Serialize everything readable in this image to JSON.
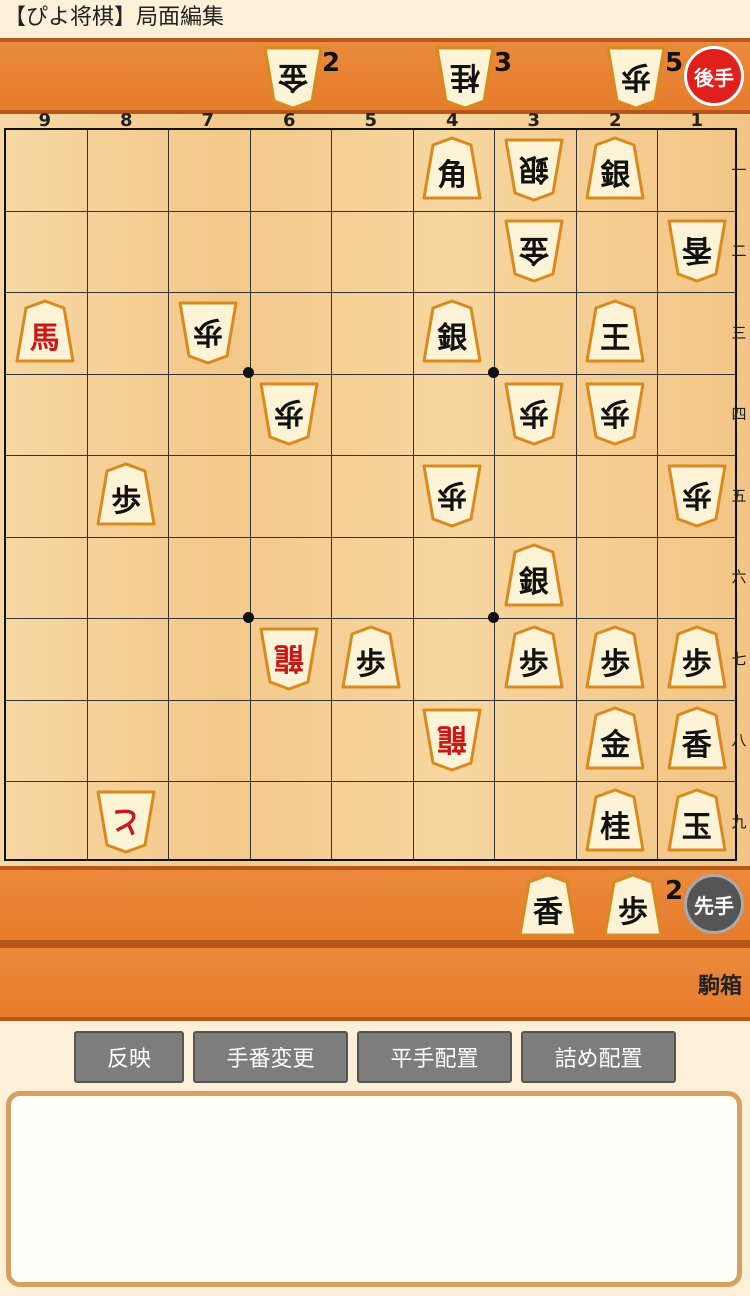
{
  "title": "【ぴよ将棋】局面編集",
  "col_labels": [
    "9",
    "8",
    "7",
    "6",
    "5",
    "4",
    "3",
    "2",
    "1"
  ],
  "row_labels": [
    "一",
    "二",
    "三",
    "四",
    "五",
    "六",
    "七",
    "八",
    "九"
  ],
  "board": [
    {
      "file": 4,
      "rank": 1,
      "char": "角",
      "owner": "sente",
      "promoted": false
    },
    {
      "file": 3,
      "rank": 1,
      "char": "銀",
      "owner": "gote",
      "promoted": false
    },
    {
      "file": 2,
      "rank": 1,
      "char": "銀",
      "owner": "sente",
      "promoted": false
    },
    {
      "file": 3,
      "rank": 2,
      "char": "金",
      "owner": "gote",
      "promoted": false
    },
    {
      "file": 1,
      "rank": 2,
      "char": "香",
      "owner": "gote",
      "promoted": false
    },
    {
      "file": 9,
      "rank": 3,
      "char": "馬",
      "owner": "sente",
      "promoted": true
    },
    {
      "file": 7,
      "rank": 3,
      "char": "歩",
      "owner": "gote",
      "promoted": false
    },
    {
      "file": 4,
      "rank": 3,
      "char": "銀",
      "owner": "sente",
      "promoted": false
    },
    {
      "file": 2,
      "rank": 3,
      "char": "王",
      "owner": "sente",
      "promoted": false
    },
    {
      "file": 6,
      "rank": 4,
      "char": "歩",
      "owner": "gote",
      "promoted": false
    },
    {
      "file": 3,
      "rank": 4,
      "char": "歩",
      "owner": "gote",
      "promoted": false
    },
    {
      "file": 2,
      "rank": 4,
      "char": "歩",
      "owner": "gote",
      "promoted": false
    },
    {
      "file": 8,
      "rank": 5,
      "char": "歩",
      "owner": "sente",
      "promoted": false
    },
    {
      "file": 4,
      "rank": 5,
      "char": "歩",
      "owner": "gote",
      "promoted": false
    },
    {
      "file": 1,
      "rank": 5,
      "char": "歩",
      "owner": "gote",
      "promoted": false
    },
    {
      "file": 3,
      "rank": 6,
      "char": "銀",
      "owner": "sente",
      "promoted": false
    },
    {
      "file": 6,
      "rank": 7,
      "char": "龍",
      "owner": "gote",
      "promoted": true
    },
    {
      "file": 5,
      "rank": 7,
      "char": "歩",
      "owner": "sente",
      "promoted": false
    },
    {
      "file": 3,
      "rank": 7,
      "char": "歩",
      "owner": "sente",
      "promoted": false
    },
    {
      "file": 2,
      "rank": 7,
      "char": "歩",
      "owner": "sente",
      "promoted": false
    },
    {
      "file": 1,
      "rank": 7,
      "char": "歩",
      "owner": "sente",
      "promoted": false
    },
    {
      "file": 4,
      "rank": 8,
      "char": "龍",
      "owner": "gote",
      "promoted": true
    },
    {
      "file": 2,
      "rank": 8,
      "char": "金",
      "owner": "sente",
      "promoted": false
    },
    {
      "file": 1,
      "rank": 8,
      "char": "香",
      "owner": "sente",
      "promoted": false
    },
    {
      "file": 8,
      "rank": 9,
      "char": "と",
      "owner": "gote",
      "promoted": true
    },
    {
      "file": 2,
      "rank": 9,
      "char": "桂",
      "owner": "sente",
      "promoted": false
    },
    {
      "file": 1,
      "rank": 9,
      "char": "玉",
      "owner": "sente",
      "promoted": false
    }
  ],
  "gote_hand": [
    {
      "char": "金",
      "count": "2"
    },
    {
      "char": "桂",
      "count": "3"
    },
    {
      "char": "歩",
      "count": "5"
    }
  ],
  "sente_hand": [
    {
      "char": "香",
      "count": ""
    },
    {
      "char": "歩",
      "count": "2"
    }
  ],
  "gote_badge": "後手",
  "sente_badge": "先手",
  "komabako_label": "駒箱",
  "buttons": [
    "反映",
    "手番変更",
    "平手配置",
    "詰め配置"
  ],
  "textarea_value": "",
  "colors": {
    "stand": "#e67c2c",
    "board": "#f3c88a",
    "piece_face": "#fdf3d6",
    "promoted": "#c81818",
    "gote_badge": "#e0201c",
    "sente_badge": "#555555",
    "button": "#7d7d7d"
  }
}
